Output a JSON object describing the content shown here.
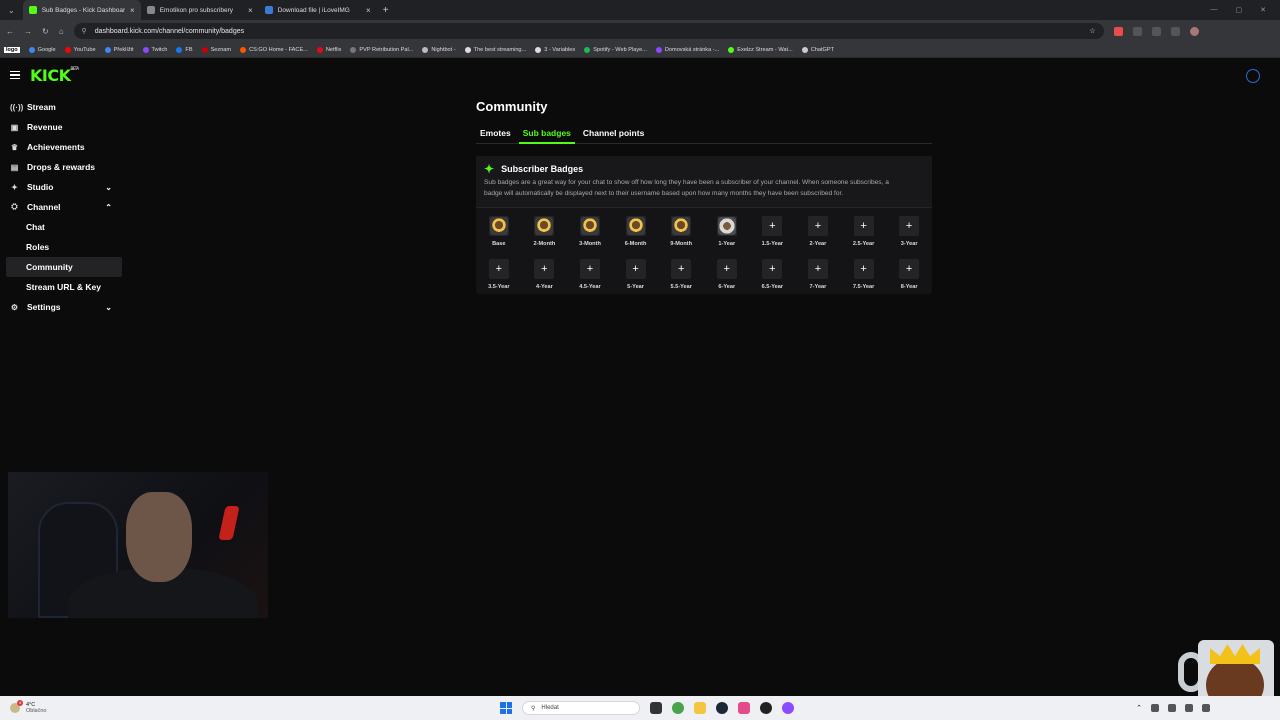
{
  "browser": {
    "tabs": [
      {
        "title": "Sub Badges - Kick Dashboard",
        "color": "#53fc18",
        "active": true
      },
      {
        "title": "Emotikon pro subscribery",
        "color": "#888888",
        "active": false
      },
      {
        "title": "Download file | iLoveIMG",
        "color": "#3a7bd5",
        "active": false
      }
    ],
    "new_tab": "+",
    "url": "dashboard.kick.com/channel/community/badges",
    "bookmarks": [
      {
        "label": "logo",
        "color": "#ffffff"
      },
      {
        "label": "Google",
        "color": "#4285f4"
      },
      {
        "label": "YouTube",
        "color": "#ff0000"
      },
      {
        "label": "Překlížit",
        "color": "#4285f4"
      },
      {
        "label": "Twitch",
        "color": "#9146ff"
      },
      {
        "label": "FB",
        "color": "#1877f2"
      },
      {
        "label": "Seznam",
        "color": "#cc0000"
      },
      {
        "label": "CS:GO Home - FACE...",
        "color": "#ff5500"
      },
      {
        "label": "Netflix",
        "color": "#e50914"
      },
      {
        "label": "PVP Retribution Pal...",
        "color": "#777777"
      },
      {
        "label": "Nightbot -",
        "color": "#bbbbbb"
      },
      {
        "label": "The best streaming...",
        "color": "#dddddd"
      },
      {
        "label": "3 - Variables",
        "color": "#dddddd"
      },
      {
        "label": "Spotify - Web Playe...",
        "color": "#1db954"
      },
      {
        "label": "Domovská stránka -...",
        "color": "#9146ff"
      },
      {
        "label": "Exelzz Stream - Wat...",
        "color": "#53fc18"
      },
      {
        "label": "ChatGPT",
        "color": "#cccccc"
      }
    ]
  },
  "sidebar": {
    "items": [
      {
        "label": "Stream",
        "icon": "stream-icon",
        "glyph": "((·))"
      },
      {
        "label": "Revenue",
        "icon": "revenue-icon",
        "glyph": "▣"
      },
      {
        "label": "Achievements",
        "icon": "trophy-icon",
        "glyph": "♛"
      },
      {
        "label": "Drops & rewards",
        "icon": "gift-icon",
        "glyph": "▤"
      },
      {
        "label": "Studio",
        "icon": "studio-icon",
        "glyph": "✦",
        "chevron": "⌄"
      },
      {
        "label": "Channel",
        "icon": "channel-icon",
        "glyph": "⛭",
        "chevron": "⌃"
      },
      {
        "label": "Chat",
        "sub": true
      },
      {
        "label": "Roles",
        "sub": true
      },
      {
        "label": "Community",
        "sub": true,
        "active": true
      },
      {
        "label": "Stream URL & Key",
        "sub": true
      },
      {
        "label": "Settings",
        "icon": "settings-icon",
        "glyph": "⚙",
        "chevron": "⌄"
      }
    ]
  },
  "main": {
    "title": "Community",
    "tabs": [
      {
        "label": "Emotes",
        "active": false
      },
      {
        "label": "Sub badges",
        "active": true
      },
      {
        "label": "Channel points",
        "active": false
      }
    ],
    "panel": {
      "title": "Subscriber Badges",
      "description": "Sub badges are a great way for your chat to show off how long they have been a subscriber of your channel. When someone subscribes, a badge will automatically be displayed next to their username based upon how many months they have been subscribed for."
    },
    "badges": [
      {
        "label": "Base",
        "filled": true
      },
      {
        "label": "2-Month",
        "filled": true
      },
      {
        "label": "3-Month",
        "filled": true
      },
      {
        "label": "6-Month",
        "filled": true
      },
      {
        "label": "9-Month",
        "filled": true
      },
      {
        "label": "1-Year",
        "filled": true,
        "alt": true
      },
      {
        "label": "1.5-Year",
        "filled": false
      },
      {
        "label": "2-Year",
        "filled": false
      },
      {
        "label": "2.5-Year",
        "filled": false
      },
      {
        "label": "3-Year",
        "filled": false
      },
      {
        "label": "3.5-Year",
        "filled": false
      },
      {
        "label": "4-Year",
        "filled": false
      },
      {
        "label": "4.5-Year",
        "filled": false
      },
      {
        "label": "5-Year",
        "filled": false
      },
      {
        "label": "5.5-Year",
        "filled": false
      },
      {
        "label": "6-Year",
        "filled": false
      },
      {
        "label": "6.5-Year",
        "filled": false
      },
      {
        "label": "7-Year",
        "filled": false
      },
      {
        "label": "7.5-Year",
        "filled": false
      },
      {
        "label": "8-Year",
        "filled": false
      }
    ],
    "add_glyph": "+"
  },
  "taskbar": {
    "weather_temp": "4°C",
    "weather_desc": "Oblačno",
    "weather_badge": "4",
    "search_placeholder": "Hledat"
  },
  "colors": {
    "accent": "#53fc18",
    "bg": "#0b0b0c"
  }
}
